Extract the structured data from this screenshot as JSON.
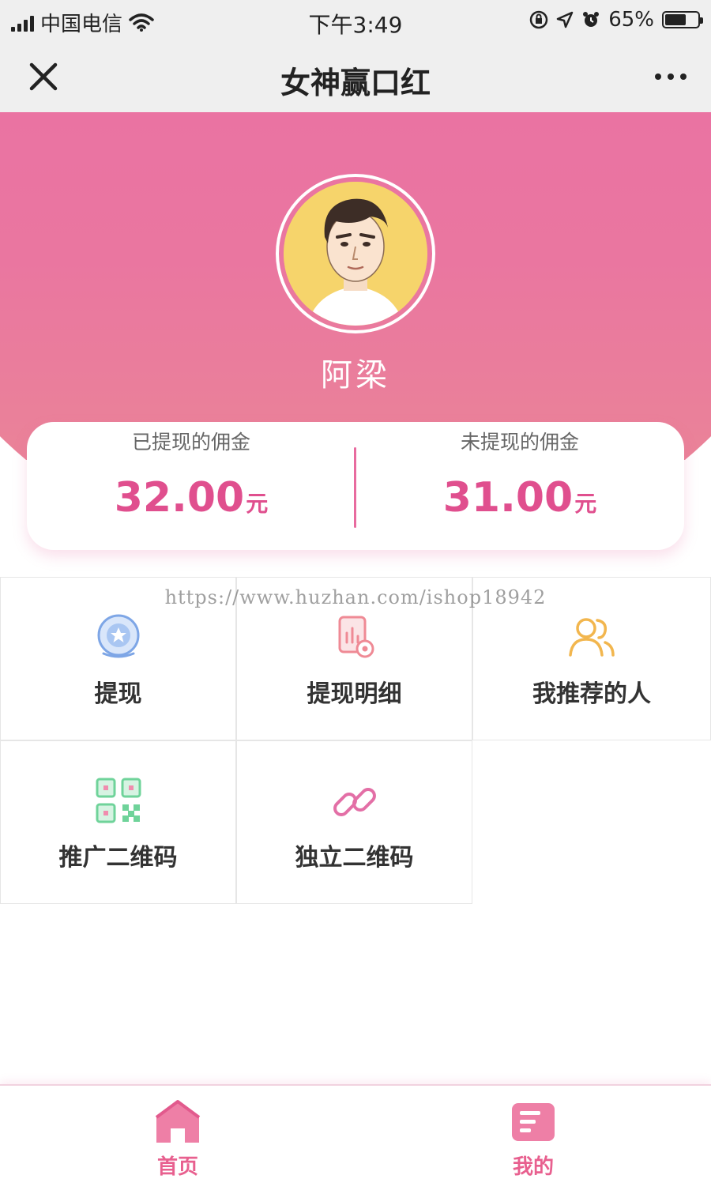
{
  "status_bar": {
    "carrier": "中国电信",
    "time": "下午3:49",
    "battery": "65%",
    "battery_level": 0.65
  },
  "nav": {
    "title": "女神赢口红"
  },
  "profile": {
    "name": "阿梁"
  },
  "commission": {
    "withdrawn_label": "已提现的佣金",
    "withdrawn_value": "32.00",
    "pending_label": "未提现的佣金",
    "pending_value": "31.00",
    "unit": "元"
  },
  "watermark": "https://www.huzhan.com/ishop18942",
  "menu": {
    "items": [
      {
        "label": "提现",
        "icon": "withdraw-icon",
        "color": "#7ea6e6"
      },
      {
        "label": "提现明细",
        "icon": "withdraw-detail-icon",
        "color": "#ef8a95"
      },
      {
        "label": "我推荐的人",
        "icon": "referrals-icon",
        "color": "#f2b64e"
      },
      {
        "label": "推广二维码",
        "icon": "qr-code-icon",
        "color": "#6fd39a"
      },
      {
        "label": "独立二维码",
        "icon": "link-icon",
        "color": "#e36fa6"
      }
    ]
  },
  "tabbar": {
    "home_label": "首页",
    "mine_label": "我的"
  },
  "colors": {
    "brand_pink": "#ea6ea6",
    "value_pink": "#e04f8e"
  }
}
